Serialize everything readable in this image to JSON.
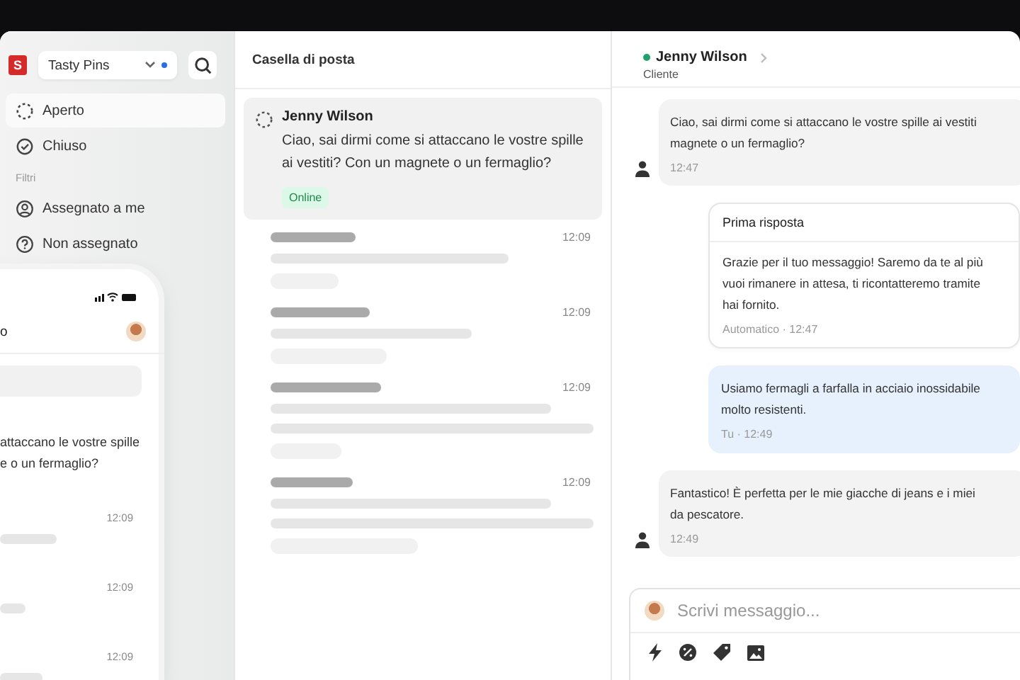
{
  "sidebar": {
    "logo": "S",
    "workspace": "Tasty Pins",
    "items": [
      {
        "label": "Aperto",
        "selected": true
      },
      {
        "label": "Chiuso",
        "selected": false
      }
    ],
    "filters_label": "Filtri",
    "filters": [
      {
        "label": "Assegnato a me"
      },
      {
        "label": "Non assegnato"
      }
    ]
  },
  "inbox": {
    "title": "Casella di posta",
    "conversation": {
      "name": "Jenny Wilson",
      "message": "Ciao, sai dirmi come si attaccano le vostre spille ai vestiti? Con un magnete o un fermaglio?",
      "badge": "Online",
      "selected": true
    },
    "placeholders": [
      {
        "time": "12:09"
      },
      {
        "time": "12:09"
      },
      {
        "time": "12:09"
      },
      {
        "time": "12:09"
      }
    ]
  },
  "chat": {
    "contact": {
      "name": "Jenny Wilson",
      "role": "Cliente",
      "online": true
    },
    "messages": [
      {
        "kind": "incoming",
        "lines": [
          "Ciao, sai dirmi come si attaccano le vostre spille ai vestiti",
          "magnete o un fermaglio?"
        ],
        "meta": "12:47"
      },
      {
        "kind": "auto",
        "title": "Prima risposta",
        "lines": [
          "Grazie per il tuo messaggio! Saremo da te al più",
          "vuoi rimanere in attesa, ti ricontatteremo tramite",
          "hai fornito."
        ],
        "meta": "Automatico · 12:47"
      },
      {
        "kind": "outgoing",
        "lines": [
          "Usiamo fermagli a farfalla in acciaio inossidabile",
          "molto resistenti."
        ],
        "meta": "Tu · 12:49"
      },
      {
        "kind": "incoming",
        "lines": [
          "Fantastico! È perfetta per le mie giacche di jeans e i miei",
          "da pescatore."
        ],
        "meta": "12:49"
      }
    ],
    "composer": {
      "placeholder": "Scrivi messaggio..."
    }
  },
  "phone": {
    "header": "o",
    "message_lines": [
      "attaccano le vostre spille",
      "e o un fermaglio?"
    ],
    "times": [
      "12:09",
      "12:09",
      "12:09"
    ]
  }
}
